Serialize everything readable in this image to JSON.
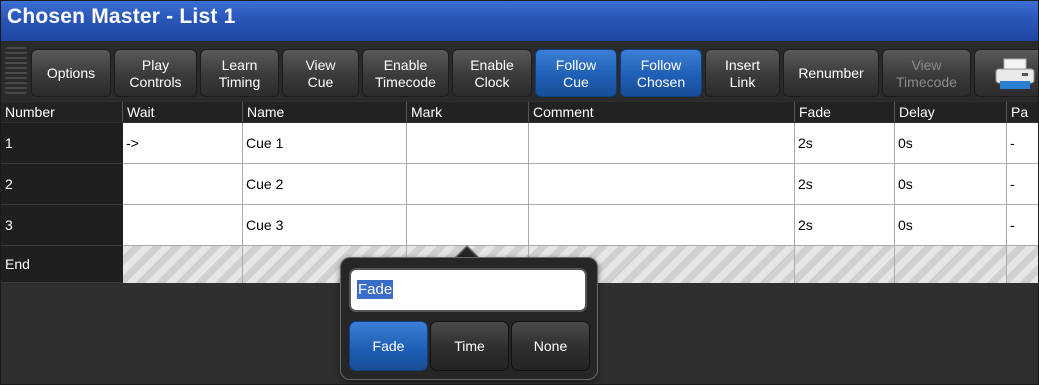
{
  "window": {
    "title": "Chosen Master - List 1"
  },
  "toolbar": {
    "buttons": [
      {
        "label": "Options",
        "style": "normal"
      },
      {
        "label": "Play\nControls",
        "style": "normal"
      },
      {
        "label": "Learn\nTiming",
        "style": "normal"
      },
      {
        "label": "View\nCue",
        "style": "normal"
      },
      {
        "label": "Enable\nTimecode",
        "style": "normal"
      },
      {
        "label": "Enable\nClock",
        "style": "normal"
      },
      {
        "label": "Follow\nCue",
        "style": "active"
      },
      {
        "label": "Follow\nChosen",
        "style": "active"
      },
      {
        "label": "Insert\nLink",
        "style": "normal"
      },
      {
        "label": "Renumber",
        "style": "normal"
      },
      {
        "label": "View\nTimecode",
        "style": "disabled"
      }
    ],
    "printer_icon": "printer-icon"
  },
  "table": {
    "columns": [
      "Number",
      "Wait",
      "Name",
      "Mark",
      "Comment",
      "Fade",
      "Delay",
      "Pa"
    ],
    "rows": [
      {
        "number": "1",
        "wait": "->",
        "name": "Cue 1",
        "mark": "",
        "comment": "",
        "fade": "2s",
        "delay": "0s",
        "path": "-"
      },
      {
        "number": "2",
        "wait": "",
        "name": "Cue 2",
        "mark": "",
        "comment": "",
        "fade": "2s",
        "delay": "0s",
        "path": "-"
      },
      {
        "number": "3",
        "wait": "",
        "name": "Cue 3",
        "mark": "",
        "comment": "",
        "fade": "2s",
        "delay": "0s",
        "path": "-"
      }
    ],
    "end_label": "End"
  },
  "popup": {
    "input_value": "Fade",
    "options": [
      "Fade",
      "Time",
      "None"
    ],
    "selected": "Fade"
  },
  "colors": {
    "title_bar": "#2a56b8",
    "active_button": "#1f5fb6",
    "selection": "#3a6cc9"
  }
}
